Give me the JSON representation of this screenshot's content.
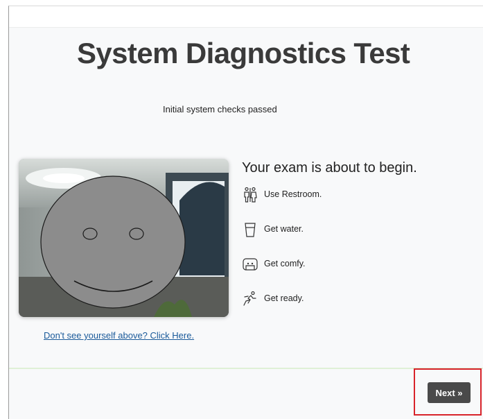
{
  "page": {
    "title": "System Diagnostics Test",
    "status": "Initial system checks passed"
  },
  "camera": {
    "help_link": "Don't see yourself above? Click Here."
  },
  "exam": {
    "heading": "Your exam is about to begin.",
    "checklist": [
      {
        "icon": "restroom-icon",
        "label": "Use Restroom."
      },
      {
        "icon": "water-glass-icon",
        "label": "Get water."
      },
      {
        "icon": "armchair-icon",
        "label": "Get comfy."
      },
      {
        "icon": "runner-icon",
        "label": "Get ready."
      }
    ]
  },
  "footer": {
    "next_label": "Next »",
    "highlight_color": "#d8232a"
  },
  "colors": {
    "panel_background": "#f8f9fa",
    "title_text": "#3a3a3a",
    "link": "#1a5a9a",
    "button": "#4a4a4a"
  }
}
